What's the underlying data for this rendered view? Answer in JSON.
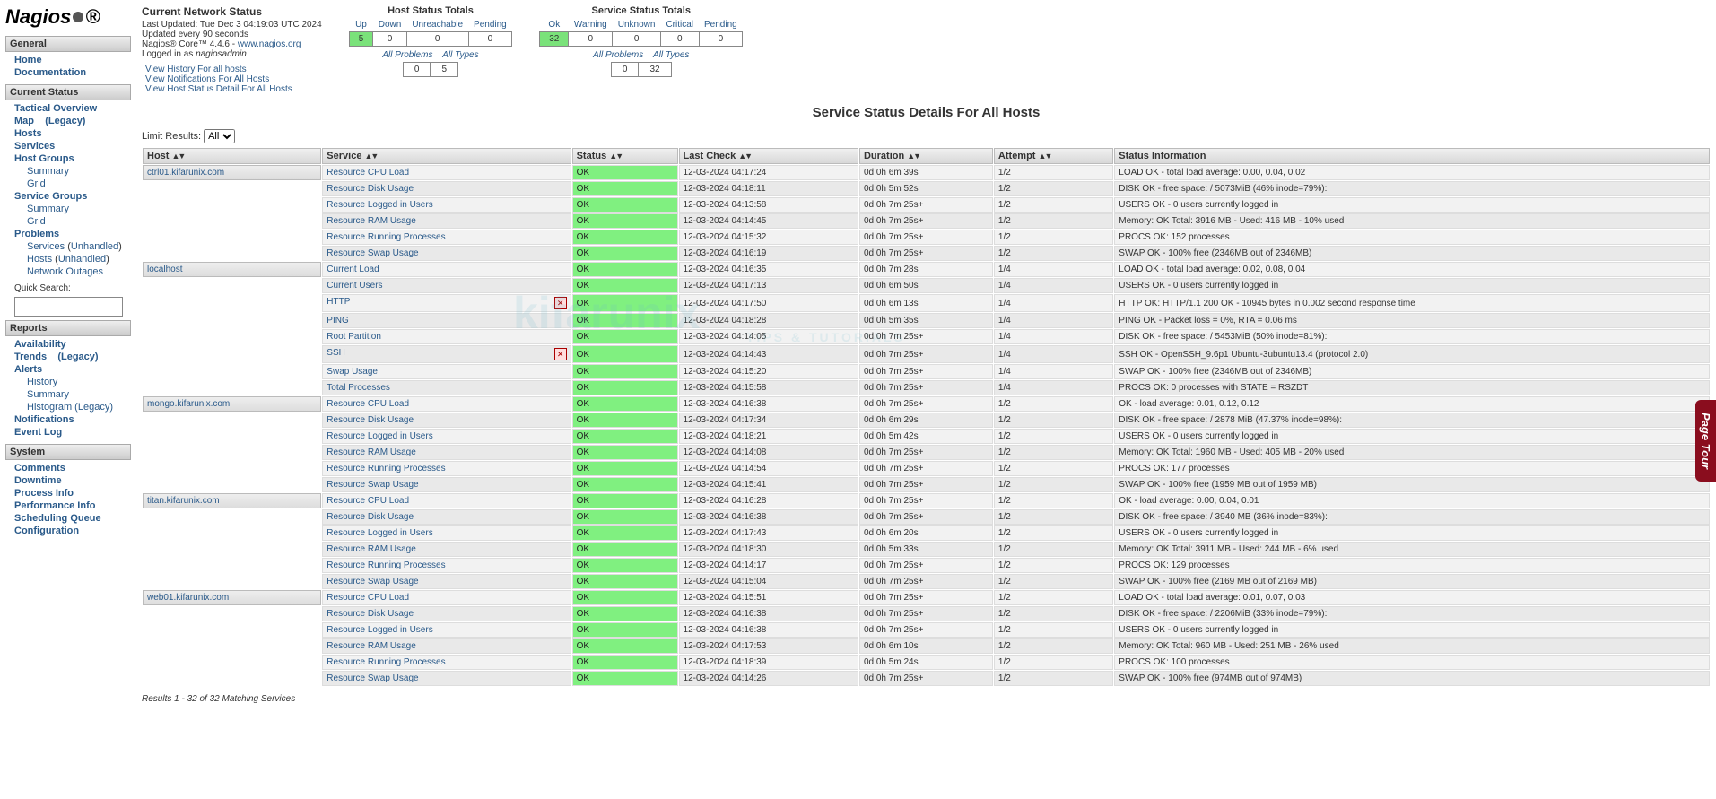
{
  "logo": "Nagios",
  "sidebar": {
    "general": {
      "header": "General",
      "items": [
        "Home",
        "Documentation"
      ]
    },
    "currentStatus": {
      "header": "Current Status",
      "items": [
        {
          "label": "Tactical Overview"
        },
        {
          "label": "Map",
          "extra": "(Legacy)"
        },
        {
          "label": "Hosts"
        },
        {
          "label": "Services"
        },
        {
          "label": "Host Groups",
          "subs": [
            "Summary",
            "Grid"
          ]
        },
        {
          "label": "Service Groups",
          "subs": [
            "Summary",
            "Grid"
          ]
        },
        {
          "label": "Problems",
          "subs_special": [
            {
              "pre": "Services",
              "paren": "Unhandled"
            },
            {
              "pre": "Hosts",
              "paren": "Unhandled"
            },
            {
              "pre": "Network Outages"
            }
          ]
        }
      ],
      "quicksearch_label": "Quick Search:"
    },
    "reports": {
      "header": "Reports",
      "items": [
        {
          "label": "Availability"
        },
        {
          "label": "Trends",
          "extra": "(Legacy)"
        },
        {
          "label": "Alerts",
          "subs": [
            "History",
            "Summary",
            "Histogram (Legacy)"
          ]
        },
        {
          "label": "Notifications"
        },
        {
          "label": "Event Log"
        }
      ]
    },
    "system": {
      "header": "System",
      "items": [
        "Comments",
        "Downtime",
        "Process Info",
        "Performance Info",
        "Scheduling Queue",
        "Configuration"
      ]
    }
  },
  "info": {
    "title": "Current Network Status",
    "updated": "Last Updated: Tue Dec 3 04:19:03 UTC 2024",
    "refresh": "Updated every 90 seconds",
    "version_pre": "Nagios® Core™ 4.4.6 - ",
    "version_link": "www.nagios.org",
    "logged_in_pre": "Logged in as ",
    "logged_in_user": "nagiosadmin",
    "links": [
      "View History For all hosts",
      "View Notifications For All Hosts",
      "View Host Status Detail For All Hosts"
    ]
  },
  "hostTotals": {
    "title": "Host Status Totals",
    "headers": [
      "Up",
      "Down",
      "Unreachable",
      "Pending"
    ],
    "values": [
      "5",
      "0",
      "0",
      "0"
    ],
    "subheaders": [
      "All Problems",
      "All Types"
    ],
    "subvalues": [
      "0",
      "5"
    ]
  },
  "serviceTotals": {
    "title": "Service Status Totals",
    "headers": [
      "Ok",
      "Warning",
      "Unknown",
      "Critical",
      "Pending"
    ],
    "values": [
      "32",
      "0",
      "0",
      "0",
      "0"
    ],
    "subheaders": [
      "All Problems",
      "All Types"
    ],
    "subvalues": [
      "0",
      "32"
    ]
  },
  "page_title": "Service Status Details For All Hosts",
  "limit_label": "Limit Results:",
  "limit_value": "All",
  "columns": [
    "Host",
    "Service",
    "Status",
    "Last Check",
    "Duration",
    "Attempt",
    "Status Information"
  ],
  "hosts": [
    {
      "name": "ctrl01.kifarunix.com",
      "services": [
        {
          "s": "Resource CPU Load",
          "st": "OK",
          "lc": "12-03-2024 04:17:24",
          "d": "0d 0h 6m 39s",
          "a": "1/2",
          "i": "LOAD OK - total load average: 0.00, 0.04, 0.02"
        },
        {
          "s": "Resource Disk Usage",
          "st": "OK",
          "lc": "12-03-2024 04:18:11",
          "d": "0d 0h 5m 52s",
          "a": "1/2",
          "i": "DISK OK - free space: / 5073MiB (46% inode=79%):"
        },
        {
          "s": "Resource Logged in Users",
          "st": "OK",
          "lc": "12-03-2024 04:13:58",
          "d": "0d 0h 7m 25s+",
          "a": "1/2",
          "i": "USERS OK - 0 users currently logged in"
        },
        {
          "s": "Resource RAM Usage",
          "st": "OK",
          "lc": "12-03-2024 04:14:45",
          "d": "0d 0h 7m 25s+",
          "a": "1/2",
          "i": "Memory: OK Total: 3916 MB - Used: 416 MB - 10% used"
        },
        {
          "s": "Resource Running Processes",
          "st": "OK",
          "lc": "12-03-2024 04:15:32",
          "d": "0d 0h 7m 25s+",
          "a": "1/2",
          "i": "PROCS OK: 152 processes"
        },
        {
          "s": "Resource Swap Usage",
          "st": "OK",
          "lc": "12-03-2024 04:16:19",
          "d": "0d 0h 7m 25s+",
          "a": "1/2",
          "i": "SWAP OK - 100% free (2346MB out of 2346MB)"
        }
      ]
    },
    {
      "name": "localhost",
      "services": [
        {
          "s": "Current Load",
          "st": "OK",
          "lc": "12-03-2024 04:16:35",
          "d": "0d 0h 7m 28s",
          "a": "1/4",
          "i": "LOAD OK - total load average: 0.02, 0.08, 0.04"
        },
        {
          "s": "Current Users",
          "st": "OK",
          "lc": "12-03-2024 04:17:13",
          "d": "0d 0h 6m 50s",
          "a": "1/4",
          "i": "USERS OK - 0 users currently logged in"
        },
        {
          "s": "HTTP",
          "flag": true,
          "st": "OK",
          "lc": "12-03-2024 04:17:50",
          "d": "0d 0h 6m 13s",
          "a": "1/4",
          "i": "HTTP OK: HTTP/1.1 200 OK - 10945 bytes in 0.002 second response time"
        },
        {
          "s": "PING",
          "st": "OK",
          "lc": "12-03-2024 04:18:28",
          "d": "0d 0h 5m 35s",
          "a": "1/4",
          "i": "PING OK - Packet loss = 0%, RTA = 0.06 ms"
        },
        {
          "s": "Root Partition",
          "st": "OK",
          "lc": "12-03-2024 04:14:05",
          "d": "0d 0h 7m 25s+",
          "a": "1/4",
          "i": "DISK OK - free space: / 5453MiB (50% inode=81%):"
        },
        {
          "s": "SSH",
          "flag": true,
          "st": "OK",
          "lc": "12-03-2024 04:14:43",
          "d": "0d 0h 7m 25s+",
          "a": "1/4",
          "i": "SSH OK - OpenSSH_9.6p1 Ubuntu-3ubuntu13.4 (protocol 2.0)"
        },
        {
          "s": "Swap Usage",
          "st": "OK",
          "lc": "12-03-2024 04:15:20",
          "d": "0d 0h 7m 25s+",
          "a": "1/4",
          "i": "SWAP OK - 100% free (2346MB out of 2346MB)"
        },
        {
          "s": "Total Processes",
          "st": "OK",
          "lc": "12-03-2024 04:15:58",
          "d": "0d 0h 7m 25s+",
          "a": "1/4",
          "i": "PROCS OK: 0 processes with STATE = RSZDT"
        }
      ]
    },
    {
      "name": "mongo.kifarunix.com",
      "services": [
        {
          "s": "Resource CPU Load",
          "st": "OK",
          "lc": "12-03-2024 04:16:38",
          "d": "0d 0h 7m 25s+",
          "a": "1/2",
          "i": "OK - load average: 0.01, 0.12, 0.12"
        },
        {
          "s": "Resource Disk Usage",
          "st": "OK",
          "lc": "12-03-2024 04:17:34",
          "d": "0d 0h 6m 29s",
          "a": "1/2",
          "i": "DISK OK - free space: / 2878 MiB (47.37% inode=98%):"
        },
        {
          "s": "Resource Logged in Users",
          "st": "OK",
          "lc": "12-03-2024 04:18:21",
          "d": "0d 0h 5m 42s",
          "a": "1/2",
          "i": "USERS OK - 0 users currently logged in"
        },
        {
          "s": "Resource RAM Usage",
          "st": "OK",
          "lc": "12-03-2024 04:14:08",
          "d": "0d 0h 7m 25s+",
          "a": "1/2",
          "i": "Memory: OK Total: 1960 MB - Used: 405 MB - 20% used"
        },
        {
          "s": "Resource Running Processes",
          "st": "OK",
          "lc": "12-03-2024 04:14:54",
          "d": "0d 0h 7m 25s+",
          "a": "1/2",
          "i": "PROCS OK: 177 processes"
        },
        {
          "s": "Resource Swap Usage",
          "st": "OK",
          "lc": "12-03-2024 04:15:41",
          "d": "0d 0h 7m 25s+",
          "a": "1/2",
          "i": "SWAP OK - 100% free (1959 MB out of 1959 MB)"
        }
      ]
    },
    {
      "name": "titan.kifarunix.com",
      "services": [
        {
          "s": "Resource CPU Load",
          "st": "OK",
          "lc": "12-03-2024 04:16:28",
          "d": "0d 0h 7m 25s+",
          "a": "1/2",
          "i": "OK - load average: 0.00, 0.04, 0.01"
        },
        {
          "s": "Resource Disk Usage",
          "st": "OK",
          "lc": "12-03-2024 04:16:38",
          "d": "0d 0h 7m 25s+",
          "a": "1/2",
          "i": "DISK OK - free space: / 3940 MB (36% inode=83%):"
        },
        {
          "s": "Resource Logged in Users",
          "st": "OK",
          "lc": "12-03-2024 04:17:43",
          "d": "0d 0h 6m 20s",
          "a": "1/2",
          "i": "USERS OK - 0 users currently logged in"
        },
        {
          "s": "Resource RAM Usage",
          "st": "OK",
          "lc": "12-03-2024 04:18:30",
          "d": "0d 0h 5m 33s",
          "a": "1/2",
          "i": "Memory: OK Total: 3911 MB - Used: 244 MB - 6% used"
        },
        {
          "s": "Resource Running Processes",
          "st": "OK",
          "lc": "12-03-2024 04:14:17",
          "d": "0d 0h 7m 25s+",
          "a": "1/2",
          "i": "PROCS OK: 129 processes"
        },
        {
          "s": "Resource Swap Usage",
          "st": "OK",
          "lc": "12-03-2024 04:15:04",
          "d": "0d 0h 7m 25s+",
          "a": "1/2",
          "i": "SWAP OK - 100% free (2169 MB out of 2169 MB)"
        }
      ]
    },
    {
      "name": "web01.kifarunix.com",
      "services": [
        {
          "s": "Resource CPU Load",
          "st": "OK",
          "lc": "12-03-2024 04:15:51",
          "d": "0d 0h 7m 25s+",
          "a": "1/2",
          "i": "LOAD OK - total load average: 0.01, 0.07, 0.03"
        },
        {
          "s": "Resource Disk Usage",
          "st": "OK",
          "lc": "12-03-2024 04:16:38",
          "d": "0d 0h 7m 25s+",
          "a": "1/2",
          "i": "DISK OK - free space: / 2206MiB (33% inode=79%):"
        },
        {
          "s": "Resource Logged in Users",
          "st": "OK",
          "lc": "12-03-2024 04:16:38",
          "d": "0d 0h 7m 25s+",
          "a": "1/2",
          "i": "USERS OK - 0 users currently logged in"
        },
        {
          "s": "Resource RAM Usage",
          "st": "OK",
          "lc": "12-03-2024 04:17:53",
          "d": "0d 0h 6m 10s",
          "a": "1/2",
          "i": "Memory: OK Total: 960 MB - Used: 251 MB - 26% used"
        },
        {
          "s": "Resource Running Processes",
          "st": "OK",
          "lc": "12-03-2024 04:18:39",
          "d": "0d 0h 5m 24s",
          "a": "1/2",
          "i": "PROCS OK: 100 processes"
        },
        {
          "s": "Resource Swap Usage",
          "st": "OK",
          "lc": "12-03-2024 04:14:26",
          "d": "0d 0h 7m 25s+",
          "a": "1/2",
          "i": "SWAP OK - 100% free (974MB out of 974MB)"
        }
      ]
    }
  ],
  "results_text": "Results 1 - 32 of 32 Matching Services",
  "page_tour": "Page Tour"
}
